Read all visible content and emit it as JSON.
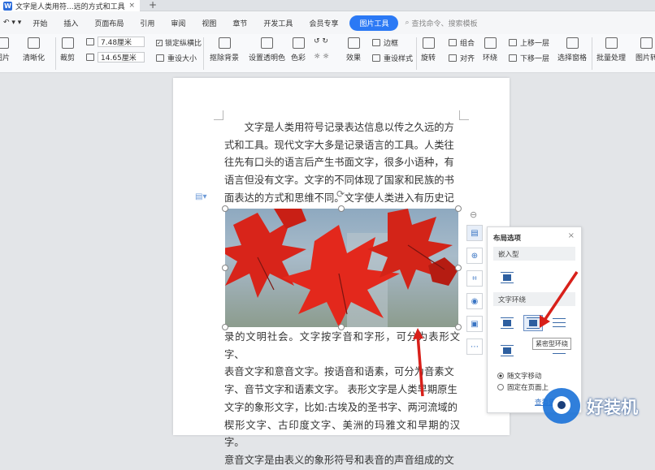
{
  "tabbar": {
    "doc_title": "文字是人类用符...远的方式和工具",
    "close": "×",
    "add": "+"
  },
  "menubar": {
    "items": [
      "开始",
      "插入",
      "页面布局",
      "引用",
      "审阅",
      "视图",
      "章节",
      "开发工具",
      "会员专享"
    ],
    "active": "图片工具",
    "search_placeholder": "查找命令、搜索模板"
  },
  "ribbon": {
    "insert_picture": "图片",
    "clarify": "清晰化",
    "crop": "裁剪",
    "width_value": "7.48厘米",
    "height_value": "14.65厘米",
    "lock_ratio": "锁定纵横比",
    "reset_size": "重设大小",
    "remove_bg": "抠除背景",
    "transparent": "设置透明色",
    "color": "色彩",
    "effect": "效果",
    "border": "边框",
    "reset_style": "重设样式",
    "rotate": "旋转",
    "group": "组合",
    "align": "对齐",
    "wrap": "环绕",
    "bring_forward": "上移一层",
    "send_backward": "下移一层",
    "selection_pane": "选择窗格",
    "batch": "批量处理",
    "pic_more": "图片转"
  },
  "document": {
    "para1": [
      "文字是人类用符号记录表达信息以传之久远的方",
      "式和工具。现代文字大多是记录语言的工具。人类往",
      "往先有口头的语言后产生书面文字，很多小语种，有",
      "语言但没有文字。文字的不同体现了国家和民族的书",
      "面表达的方式和思维不同。文字使人类进入有历史记"
    ],
    "para2": [
      "录的文明社会。文字按字音和字形，可分为表形文字、",
      "表音文字和意音文字。按语音和语素，可分为音素文",
      "字、音节文字和语素文字。 表形文字是人类早期原生",
      "文字的象形文字，比如:古埃及的圣书字、两河流域的",
      "楔形文字、古印度文字、美洲的玛雅文和早期的汉字。",
      "意音文字是由表义的象形符号和表音的声音组成的文"
    ]
  },
  "layout_panel": {
    "title": "布局选项",
    "inline_section": "嵌入型",
    "wrap_section": "文字环绕",
    "tooltip": "紧密型环绕",
    "move_with_text": "随文字移动",
    "fix_on_page": "固定在页面上",
    "more_link": "查看更多"
  },
  "watermark": {
    "text": "好装机"
  }
}
